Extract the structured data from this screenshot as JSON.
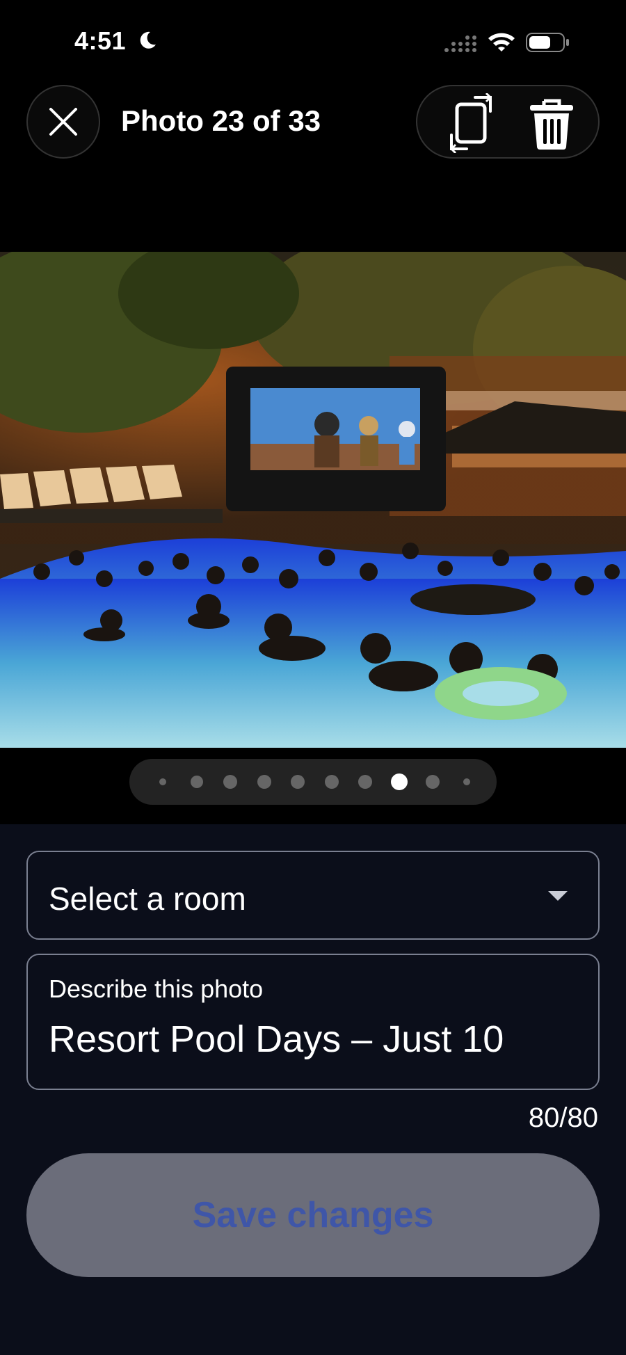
{
  "status_bar": {
    "time": "4:51",
    "icons": [
      "moon-icon",
      "signal-icon",
      "wifi-icon",
      "battery-icon"
    ]
  },
  "header": {
    "close_icon": "close-icon",
    "counter": "Photo 23 of 33",
    "rotate_icon": "rotate-icon",
    "delete_icon": "trash-icon"
  },
  "photo": {
    "description": "Night pool scene with an inflatable outdoor movie screen"
  },
  "pagination": {
    "total_dots": 10,
    "active_index": 7
  },
  "form": {
    "room_select": {
      "value": "Select a room"
    },
    "description": {
      "label": "Describe this photo",
      "value": "Resort Pool Days – Just 10"
    },
    "char_count": "80/80"
  },
  "actions": {
    "save_label": "Save changes"
  },
  "colors": {
    "background": "#0b0e1a",
    "top_background": "#000000",
    "save_button_bg": "#6b6d7a",
    "save_button_text": "#3f56a8",
    "field_border": "#7a7f90"
  }
}
